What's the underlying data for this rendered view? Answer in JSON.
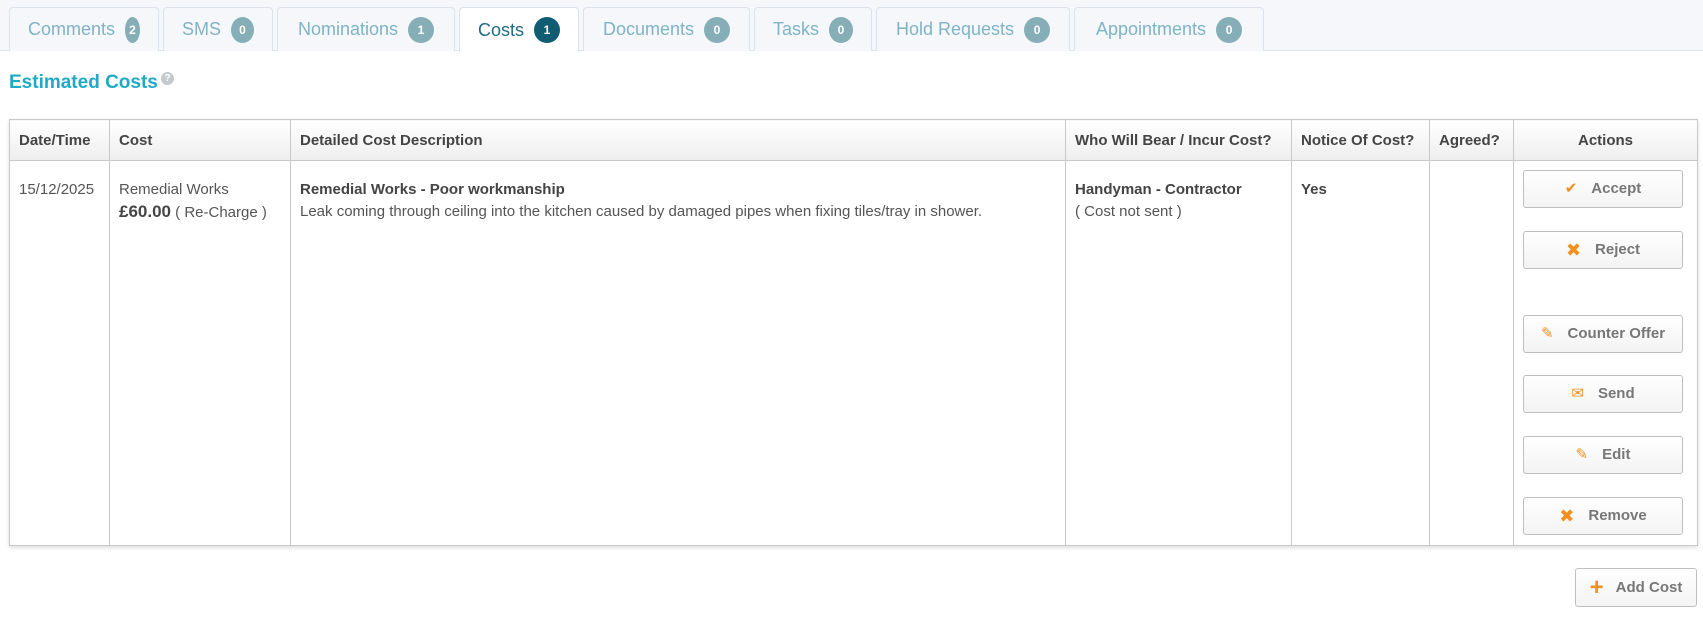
{
  "tabs": [
    {
      "label": "Comments",
      "count": "2"
    },
    {
      "label": "SMS",
      "count": "0"
    },
    {
      "label": "Nominations",
      "count": "1"
    },
    {
      "label": "Costs",
      "count": "1",
      "active": true
    },
    {
      "label": "Documents",
      "count": "0"
    },
    {
      "label": "Tasks",
      "count": "0"
    },
    {
      "label": "Hold Requests",
      "count": "0"
    },
    {
      "label": "Appointments",
      "count": "0"
    }
  ],
  "section": {
    "title": "Estimated Costs",
    "help_glyph": "?"
  },
  "table": {
    "headers": {
      "datetime": "Date/Time",
      "cost": "Cost",
      "description": "Detailed Cost Description",
      "bearer": "Who Will Bear / Incur Cost?",
      "notice": "Notice Of Cost?",
      "agreed": "Agreed?",
      "actions": "Actions"
    },
    "row": {
      "datetime": "15/12/2025",
      "cost_type": "Remedial Works",
      "cost_amount": "£60.00",
      "cost_kind": "( Re-Charge )",
      "desc_title": "Remedial Works - Poor workmanship",
      "desc_body": "Leak coming through ceiling into the kitchen caused by damaged pipes when fixing tiles/tray in shower.",
      "bearer": "Handyman - Contractor",
      "bearer_status": "( Cost not sent )",
      "notice": "Yes",
      "agreed": ""
    }
  },
  "actions": {
    "accept": "Accept",
    "reject": "Reject",
    "counter_offer": "Counter Offer",
    "send": "Send",
    "edit": "Edit",
    "remove": "Remove"
  },
  "add_cost": "Add Cost",
  "icons": {
    "accept": "check-icon",
    "reject": "cross-icon",
    "counter_offer": "pencil-icon",
    "send": "envelope-icon",
    "edit": "pencil-icon",
    "remove": "cross-icon",
    "add_cost": "plus-icon"
  },
  "colors": {
    "accent": "#21a9c6",
    "tab_text": "#7fb3c6",
    "active_badge": "#0f5c73",
    "badge": "#86aeb7",
    "icon_orange": "#f0901e"
  }
}
